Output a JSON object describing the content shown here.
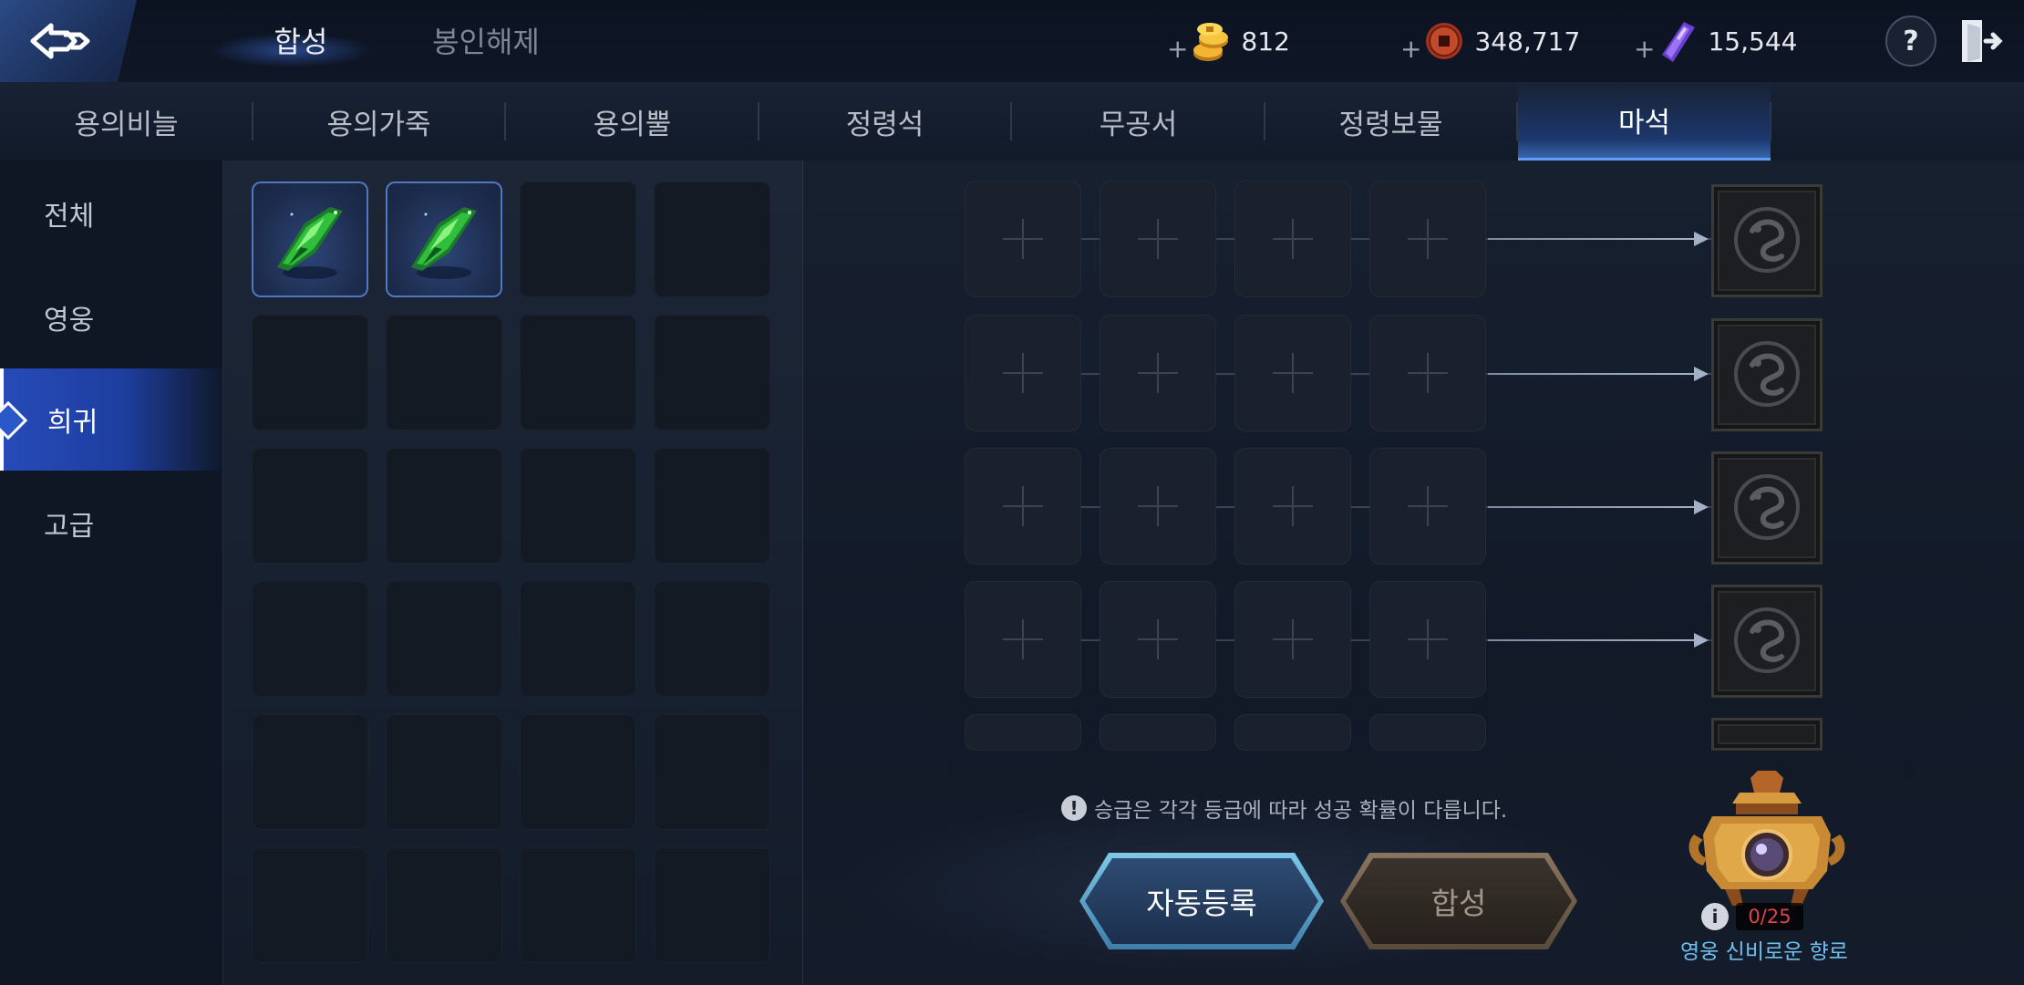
{
  "header": {
    "main_tabs": [
      {
        "label": "합성",
        "active": true
      },
      {
        "label": "봉인해제",
        "active": false
      }
    ],
    "currencies": [
      {
        "icon": "gold-coin-icon",
        "value": "812"
      },
      {
        "icon": "copper-coin-icon",
        "value": "348,717"
      },
      {
        "icon": "purple-crystal-icon",
        "value": "15,544"
      }
    ],
    "help_label": "?"
  },
  "category_tabs": [
    {
      "label": "용의비늘",
      "active": false
    },
    {
      "label": "용의가죽",
      "active": false
    },
    {
      "label": "용의뿔",
      "active": false
    },
    {
      "label": "정령석",
      "active": false
    },
    {
      "label": "무공서",
      "active": false
    },
    {
      "label": "정령보물",
      "active": false
    },
    {
      "label": "마석",
      "active": true
    }
  ],
  "rarity_filters": [
    {
      "label": "전체",
      "active": false
    },
    {
      "label": "영웅",
      "active": false
    },
    {
      "label": "희귀",
      "active": true
    },
    {
      "label": "고급",
      "active": false
    }
  ],
  "inventory": {
    "items": [
      {
        "name": "green-magic-stone",
        "icon": "green-crystal-icon"
      },
      {
        "name": "green-magic-stone",
        "icon": "green-crystal-icon"
      }
    ]
  },
  "synthesis": {
    "notice": "승급은 각각 등급에 따라 성공 확률이 다릅니다.",
    "auto_register_label": "자동등록",
    "synthesize_label": "합성",
    "result_icon": "dragon-emblem-icon"
  },
  "censer": {
    "info_label": "i",
    "count": "0/25",
    "label": "영웅 신비로운 향로"
  },
  "colors": {
    "accent_blue": "#5fa0ff",
    "censer_label": "#6ec0f0",
    "count_red": "#e0434a"
  }
}
